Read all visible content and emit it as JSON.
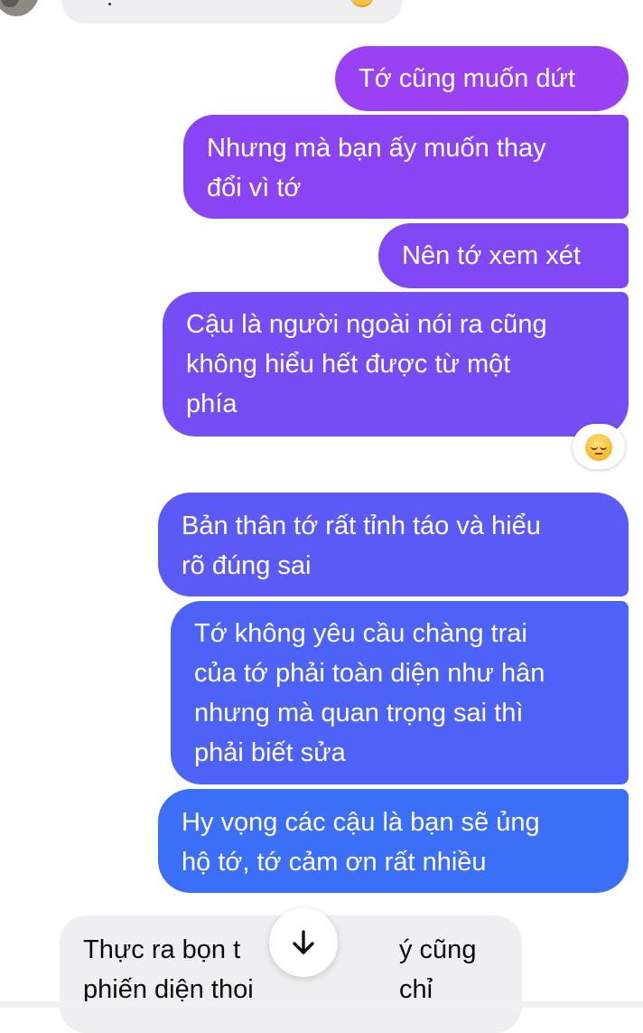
{
  "conversation": {
    "outgoing": [
      {
        "lines": [
          "Tớ cũng muốn dứt"
        ],
        "color": "#9a41f3"
      },
      {
        "lines": [
          "Nhưng mà bạn ấy muốn thay",
          "đổi vì tớ"
        ],
        "color": "#8a44f4"
      },
      {
        "lines": [
          "Nên tớ xem xét"
        ],
        "color": "#8148f5"
      },
      {
        "lines": [
          "Cậu là người ngoài nói ra cũng",
          "không hiểu hết được từ một",
          "phía"
        ],
        "color": "#744df5"
      },
      {
        "lines": [
          "Bản thân tớ rất tỉnh táo và hiểu",
          "rõ đúng sai"
        ],
        "color": "#5b5af6"
      },
      {
        "lines": [
          "Tớ không yêu cầu chàng trai",
          "của tớ phải toàn diện như hân",
          "nhưng mà quan trọng sai thì",
          "phải biết sửa"
        ],
        "color": "#4d63f7"
      },
      {
        "lines": [
          "Hy vọng các cậu là bạn sẽ ủng",
          "hộ tớ, tớ cảm ơn rất nhiều"
        ],
        "color": "#3c6ff7"
      }
    ],
    "reaction": {
      "emoji": "😔",
      "icon": "pensive-face-icon"
    },
    "incoming": {
      "lines": [
        "Thực ra bọn tớ thấy ý cũng chỉ",
        "phiến diện thoi"
      ],
      "visible_line_1_left": "Thực ra bọn t",
      "visible_line_1_right": "ý cũng chỉ",
      "color": "#efeff1"
    },
    "scroll_button": {
      "icon": "arrow-down-icon"
    }
  }
}
